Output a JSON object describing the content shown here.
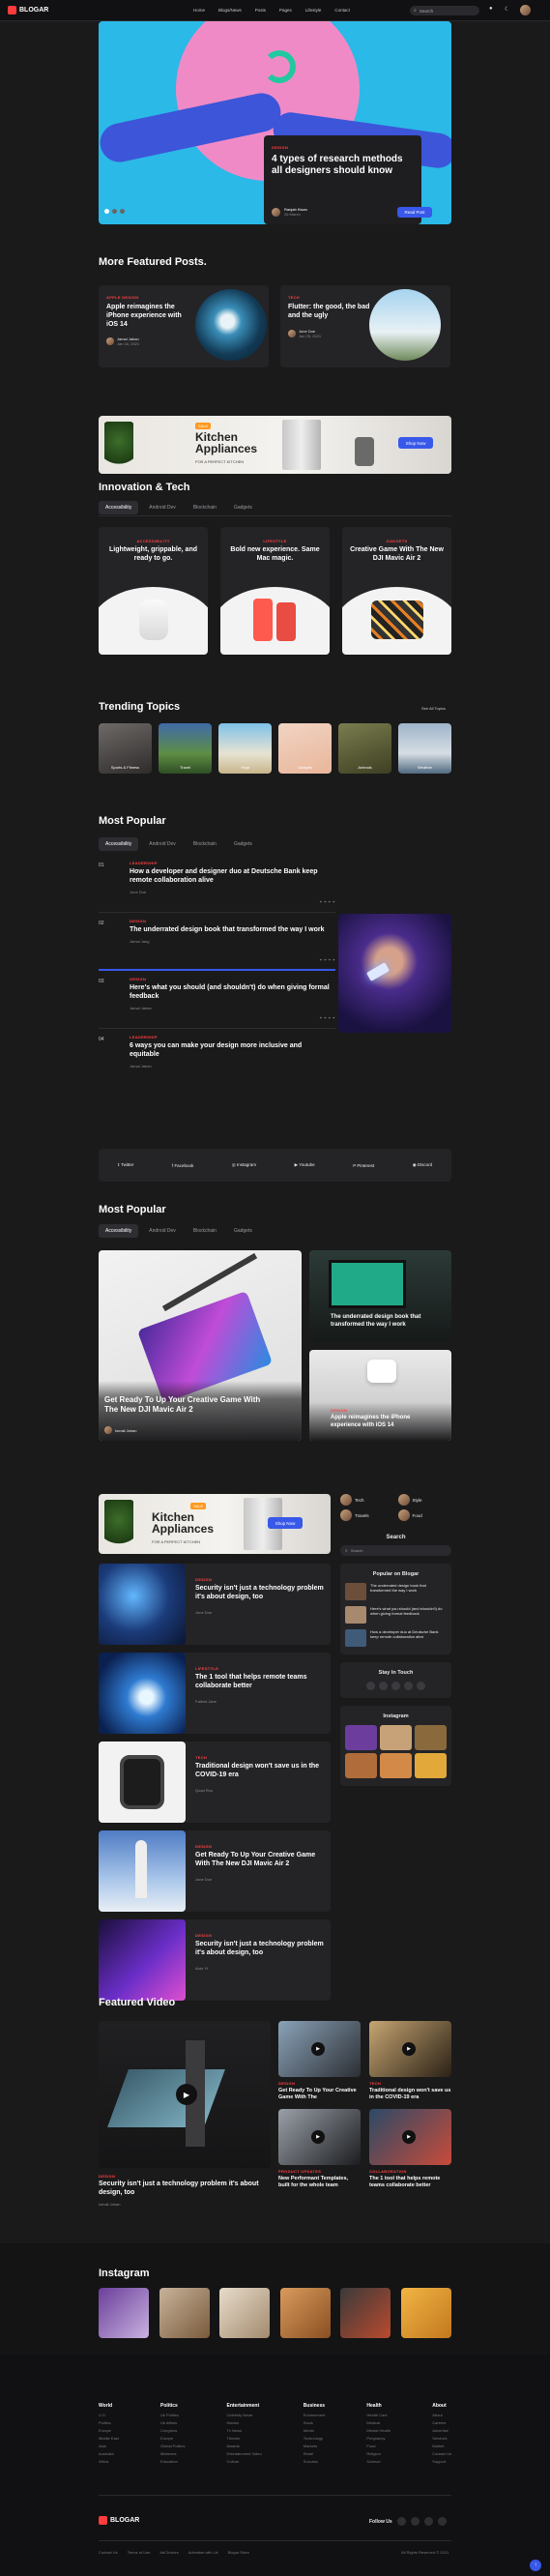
{
  "header": {
    "logo": "BLOGAR",
    "nav": [
      "Home",
      "Blogs/News",
      "Posts",
      "Pages",
      "Lifestyle",
      "Contact"
    ],
    "search_placeholder": "Search"
  },
  "hero": {
    "category": "DESIGN",
    "title": "4 types of research methods all designers should know",
    "author": "Ranjab Kisan",
    "date": "26 March",
    "button": "Read Post"
  },
  "featured": {
    "title": "More Featured Posts.",
    "posts": [
      {
        "category": "APPLE DESIGN",
        "title": "Apple reimagines the iPhone experience with iOS 14",
        "author": "Jamal Jahan",
        "date": "Jan 16, 2021"
      },
      {
        "category": "TECH",
        "title": "Flutter: the good, the bad and the ugly",
        "author": "Jone Doe",
        "date": "Jan 25, 2021"
      }
    ]
  },
  "ad": {
    "tag": "SALE",
    "title": "Kitchen Appliances",
    "sub": "FOR A PERFECT KITCHEN",
    "button": "Shop Now"
  },
  "innovation": {
    "title": "Innovation & Tech",
    "tabs": [
      "Accessibility",
      "Android Dev",
      "Blockchain",
      "Gadgets"
    ],
    "cards": [
      {
        "category": "ACCESSIBILITY",
        "title": "Lightweight, grippable, and ready to go."
      },
      {
        "category": "LIFESTYLE",
        "title": "Bold new experience. Same Mac magic."
      },
      {
        "category": "GADGETS",
        "title": "Creative Game With The New DJI Mavic Air 2"
      }
    ]
  },
  "trending": {
    "title": "Trending Topics",
    "see_all": "See All Topics",
    "topics": [
      "Sports & Fitness",
      "Travel",
      "Yoga",
      "Gadgets",
      "Animals",
      "Weather"
    ]
  },
  "popular": {
    "title": "Most Popular",
    "tabs": [
      "Accessibility",
      "Android Dev",
      "Blockchain",
      "Gadgets"
    ],
    "items": [
      {
        "num": "01",
        "category": "LEADERSHIP",
        "title": "How a developer and designer duo at Deutsche Bank keep remote collaboration alive",
        "author": "Jone Doe"
      },
      {
        "num": "02",
        "category": "DESIGN",
        "title": "The underrated design book that transformed the way I work",
        "author": "Jamal Jang"
      },
      {
        "num": "03",
        "category": "DESIGN",
        "title": "Here's what you should (and shouldn't) do when giving formal feedback",
        "author": "Jamal Jahan"
      },
      {
        "num": "04",
        "category": "LEADERSHIP",
        "title": "6 ways you can make your design more inclusive and equitable",
        "author": "Jamal Jahan"
      }
    ]
  },
  "social": [
    "Twitter",
    "Facebook",
    "Instagram",
    "Youtube",
    "Pinterest",
    "Discord"
  ],
  "popular2": {
    "title": "Most Popular",
    "tabs": [
      "Accessibility",
      "Android Dev",
      "Blockchain",
      "Gadgets"
    ],
    "main": {
      "title": "Get Ready To Up Your Creative Game With The New DJI Mavic Air 2",
      "author": "Ismail Jahan"
    },
    "side1": {
      "title": "The underrated design book that transformed the way I work"
    },
    "side2": {
      "category": "DESIGN",
      "title": "Apple reimagines the iPhone experience with iOS 14"
    }
  },
  "list": {
    "posts": [
      {
        "category": "DESIGN",
        "title": "Security isn't just a technology problem it's about design, too",
        "author": "Jone Doe"
      },
      {
        "category": "LIFESTYLE",
        "title": "The 1 tool that helps remote teams collaborate better",
        "author": "Fatima Jane"
      },
      {
        "category": "TECH",
        "title": "Traditional design won't save us in the COVID-19 era",
        "author": "Quad Roo"
      },
      {
        "category": "DESIGN",
        "title": "Get Ready To Up Your Creative Game With The New DJI Mavic Air 2",
        "author": "Jone Doe"
      },
      {
        "category": "DESIGN",
        "title": "Security isn't just a technology problem it's about design, too",
        "author": "Auto Yt"
      }
    ]
  },
  "sidebar": {
    "cats": [
      "Tech",
      "Style",
      "Travels",
      "Food"
    ],
    "search_title": "Search",
    "search_placeholder": "Search",
    "popular_title": "Popular on Blogar",
    "popular": [
      "The underrated design book that transformed the way I work",
      "Here's what you should (and shouldn't) do when giving formal feedback",
      "How a developer duo at Deutsche Bank keep remote collaboration alive"
    ],
    "stay": "Stay In Touch",
    "insta": "Instagram"
  },
  "video": {
    "title": "Featured Video",
    "main": {
      "category": "DESIGN",
      "title": "Security isn't just a technology problem it's about design, too",
      "author": "Ismail Jahan"
    },
    "items": [
      {
        "category": "DESIGN",
        "title": "Get Ready To Up Your Creative Game With The"
      },
      {
        "category": "TECH",
        "title": "Traditional design won't save us in the COVID-19 era"
      },
      {
        "category": "PRODUCT UPDATES",
        "title": "New Performant Templates, built for the whole team"
      },
      {
        "category": "COLLABORATION",
        "title": "The 1 tool that helps remote teams collaborate better"
      }
    ]
  },
  "instagram": {
    "title": "Instagram"
  },
  "footer": {
    "cols": [
      {
        "h": "World",
        "items": [
          "U.S.",
          "Politics",
          "Europe",
          "Middle East",
          "Asia",
          "Australia",
          "Africa"
        ]
      },
      {
        "h": "Politics",
        "items": [
          "Uk Politics",
          "Uk Affairs",
          "Congress",
          "Europe",
          "Global Politics",
          "Midterms",
          "Education"
        ]
      },
      {
        "h": "Entertainment",
        "items": [
          "Celebrity News",
          "Movies",
          "Tv News",
          "Theatre",
          "Awards",
          "Entertainment Video",
          "Culture"
        ]
      },
      {
        "h": "Business",
        "items": [
          "Environment",
          "Stock",
          "Media",
          "Technology",
          "Markets",
          "Retail",
          "Success"
        ]
      },
      {
        "h": "Health",
        "items": [
          "Health Care",
          "Medical",
          "Mental Health",
          "Pregnancy",
          "Food",
          "Religion",
          "Science"
        ]
      },
      {
        "h": "About",
        "items": [
          "About",
          "Careers",
          "Advertise",
          "Services",
          "Market",
          "Contact Us",
          "Support"
        ]
      }
    ],
    "logo": "BLOGAR",
    "follow": "Follow Us",
    "links": [
      "Contact Us",
      "Terms of Use",
      "AdChoices",
      "Advertise with Us",
      "Blogar Store"
    ],
    "copyright": "All Rights Reserved © 2021"
  }
}
